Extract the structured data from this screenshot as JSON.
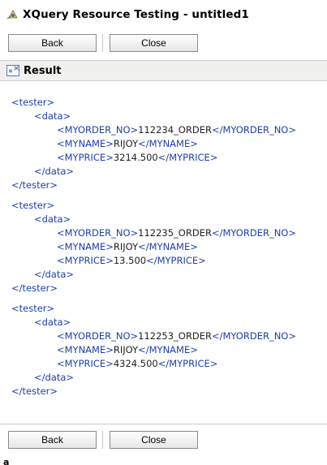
{
  "window": {
    "title": "XQuery Resource Testing - untitled1"
  },
  "toolbar": {
    "back_label": "Back",
    "close_label": "Close"
  },
  "result": {
    "title": "Result",
    "records": [
      {
        "open_root": "<tester>",
        "open_data": "<data>",
        "order_open": "<MYORDER_NO>",
        "order_value": "112234_ORDER",
        "order_close": "</MYORDER_NO>",
        "name_open": "<MYNAME>",
        "name_value": "RIJOY",
        "name_close": "</MYNAME>",
        "price_open": "<MYPRICE>",
        "price_value": "3214.500",
        "price_close": "</MYPRICE>",
        "close_data": "</data>",
        "close_root": "</tester>"
      },
      {
        "open_root": "<tester>",
        "open_data": "<data>",
        "order_open": "<MYORDER_NO>",
        "order_value": "112235_ORDER",
        "order_close": "</MYORDER_NO>",
        "name_open": "<MYNAME>",
        "name_value": "RIJOY",
        "name_close": "</MYNAME>",
        "price_open": "<MYPRICE>",
        "price_value": "13.500",
        "price_close": "</MYPRICE>",
        "close_data": "</data>",
        "close_root": "</tester>"
      },
      {
        "open_root": "<tester>",
        "open_data": "<data>",
        "order_open": "<MYORDER_NO>",
        "order_value": "112253_ORDER",
        "order_close": "</MYORDER_NO>",
        "name_open": "<MYNAME>",
        "name_value": "RIJOY",
        "name_close": "</MYNAME>",
        "price_open": "<MYPRICE>",
        "price_value": "4324.500",
        "price_close": "</MYPRICE>",
        "close_data": "</data>",
        "close_root": "</tester>"
      }
    ]
  },
  "footer": {
    "glyph": "a"
  },
  "colors": {
    "xml_tag": "#1d3fa8",
    "xml_text": "#222222",
    "section_bg": "#f0f0ee"
  }
}
